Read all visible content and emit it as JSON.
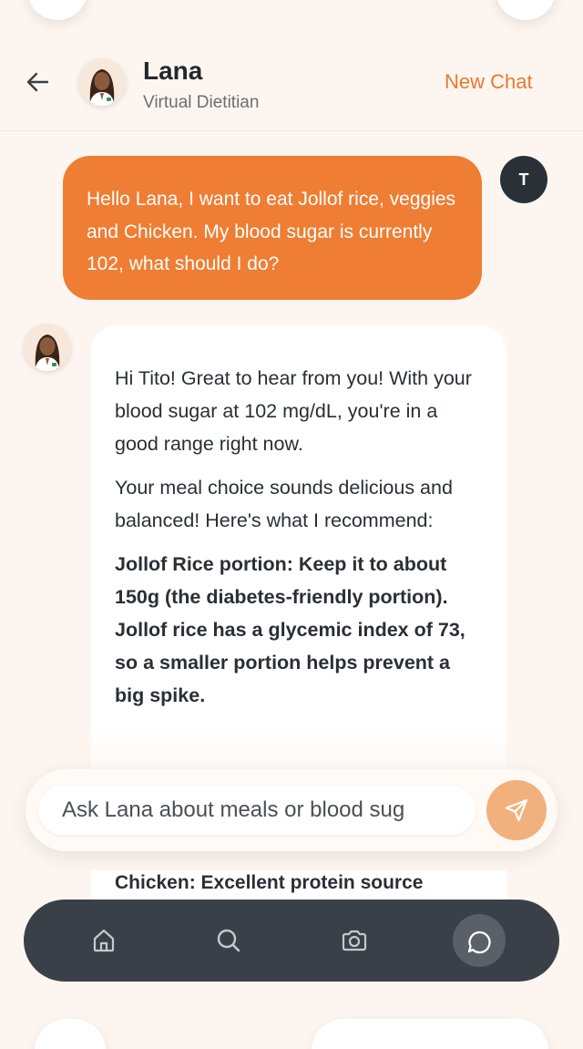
{
  "header": {
    "name": "Lana",
    "role": "Virtual Dietitian",
    "new_chat_label": "New Chat"
  },
  "messages": [
    {
      "sender": "user",
      "avatar_initial": "T",
      "text": "Hello Lana, I want to eat Jollof rice, veggies and Chicken. My blood sugar is currently 102, what should I do?"
    },
    {
      "sender": "assistant",
      "paragraphs": [
        "Hi Tito! Great to hear from you! With your blood sugar at 102 mg/dL, you're in a good range right now.",
        "Your meal choice sounds delicious and balanced! Here's what I recommend:",
        "Jollof Rice portion: Keep it to about 150g (the diabetes-friendly portion). Jollof rice has a glycemic index of 73, so a smaller portion helps prevent a big spike."
      ],
      "peek_text": "Chicken: Excellent protein source"
    }
  ],
  "composer": {
    "placeholder": "Ask Lana about meals or blood sug"
  },
  "nav": {
    "items": [
      "home-icon",
      "search-icon",
      "camera-icon",
      "chat-icon"
    ],
    "active": "chat-icon"
  },
  "colors": {
    "accent": "#ef7d33",
    "send_button": "#f2b07c",
    "nav_bg": "#3a4048",
    "page_bg": "#fdf6f0"
  }
}
